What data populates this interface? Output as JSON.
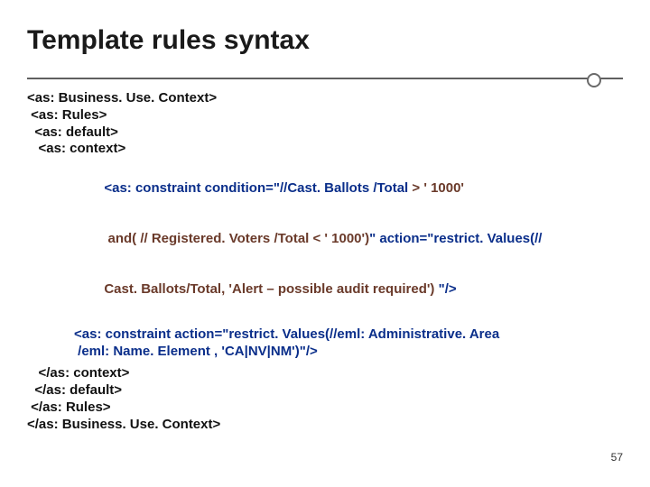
{
  "slide": {
    "title": "Template rules syntax",
    "pageNumber": "57"
  },
  "code": {
    "open": {
      "l1": "<as: Business. Use. Context>",
      "l2": " <as: Rules>",
      "l3": "  <as: default>",
      "l4": "   <as: context>"
    },
    "constraint1": {
      "l1a": "<as: constraint condition=\"//Cast. Ballots /Total ",
      "l1b": "> ' 1000'",
      "l2a": " and( // Registered. Voters /Total < ' 1000')",
      "l2b": "\" action=\"restrict. Values(// ",
      "l3a": "Cast. Ballots/Total, 'Alert – possible audit required') ",
      "l3b": "\"/>"
    },
    "constraint2": {
      "l1": "<as: constraint action=\"restrict. Values(//eml: Administrative. Area",
      "l2": " /eml: Name. Element , 'CA|NV|NM')\"/>"
    },
    "close": {
      "l1": "   </as: context>",
      "l2": "  </as: default>",
      "l3": " </as: Rules>",
      "l4": "</as: Business. Use. Context>"
    }
  }
}
